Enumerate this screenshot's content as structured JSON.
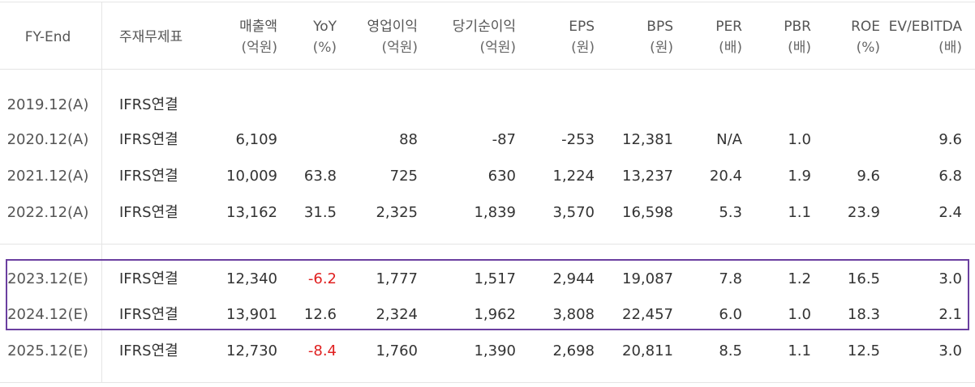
{
  "headers": [
    {
      "l1": "FY-End",
      "l2": ""
    },
    {
      "l1": "주재무제표",
      "l2": ""
    },
    {
      "l1": "매출액",
      "l2": "(억원)"
    },
    {
      "l1": "YoY",
      "l2": "(%)"
    },
    {
      "l1": "영업이익",
      "l2": "(억원)"
    },
    {
      "l1": "당기순이익",
      "l2": "(억원)"
    },
    {
      "l1": "EPS",
      "l2": "(원)"
    },
    {
      "l1": "BPS",
      "l2": "(원)"
    },
    {
      "l1": "PER",
      "l2": "(배)"
    },
    {
      "l1": "PBR",
      "l2": "(배)"
    },
    {
      "l1": "ROE",
      "l2": "(%)"
    },
    {
      "l1": "EV/EBITDA",
      "l2": "(배)"
    }
  ],
  "rows": [
    {
      "fy": "2019.12(A)",
      "type": "IFRS연결",
      "sales": "",
      "yoy": "",
      "op": "",
      "net": "",
      "eps": "",
      "bps": "",
      "per": "",
      "pbr": "",
      "roe": "",
      "ev": ""
    },
    {
      "fy": "2020.12(A)",
      "type": "IFRS연결",
      "sales": "6,109",
      "yoy": "",
      "op": "88",
      "net": "-87",
      "eps": "-253",
      "bps": "12,381",
      "per": "N/A",
      "pbr": "1.0",
      "roe": "",
      "ev": "9.6"
    },
    {
      "fy": "2021.12(A)",
      "type": "IFRS연결",
      "sales": "10,009",
      "yoy": "63.8",
      "op": "725",
      "net": "630",
      "eps": "1,224",
      "bps": "13,237",
      "per": "20.4",
      "pbr": "1.9",
      "roe": "9.6",
      "ev": "6.8"
    },
    {
      "fy": "2022.12(A)",
      "type": "IFRS연결",
      "sales": "13,162",
      "yoy": "31.5",
      "op": "2,325",
      "net": "1,839",
      "eps": "3,570",
      "bps": "16,598",
      "per": "5.3",
      "pbr": "1.1",
      "roe": "23.9",
      "ev": "2.4"
    },
    {
      "fy": "2023.12(E)",
      "type": "IFRS연결",
      "sales": "12,340",
      "yoy": "-6.2",
      "op": "1,777",
      "net": "1,517",
      "eps": "2,944",
      "bps": "19,087",
      "per": "7.8",
      "pbr": "1.2",
      "roe": "16.5",
      "ev": "3.0"
    },
    {
      "fy": "2024.12(E)",
      "type": "IFRS연결",
      "sales": "13,901",
      "yoy": "12.6",
      "op": "2,324",
      "net": "1,962",
      "eps": "3,808",
      "bps": "22,457",
      "per": "6.0",
      "pbr": "1.0",
      "roe": "18.3",
      "ev": "2.1"
    },
    {
      "fy": "2025.12(E)",
      "type": "IFRS연결",
      "sales": "12,730",
      "yoy": "-8.4",
      "op": "1,760",
      "net": "1,390",
      "eps": "2,698",
      "bps": "20,811",
      "per": "8.5",
      "pbr": "1.1",
      "roe": "12.5",
      "ev": "3.0"
    }
  ],
  "colors": {
    "negative_yoy": "#e02020",
    "highlight_border": "#6b3fa0",
    "grid": "#e5e5e5"
  }
}
